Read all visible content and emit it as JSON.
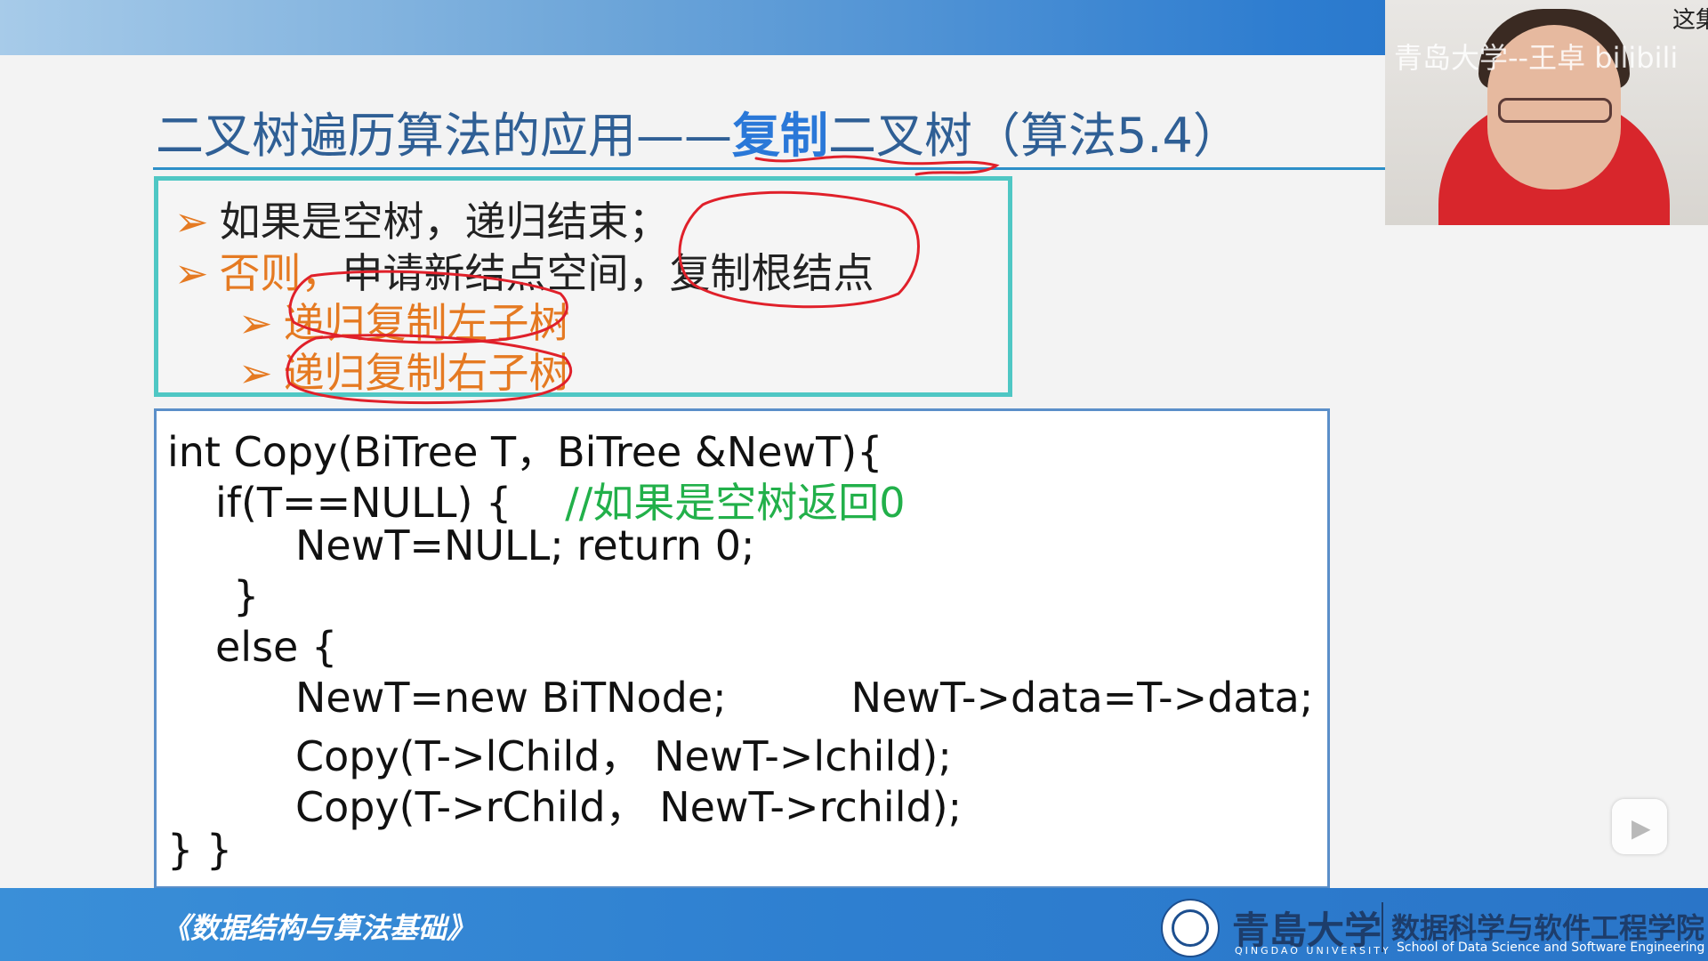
{
  "slide": {
    "title_pre": "二叉树遍历算法的应用——",
    "title_hl": "复制",
    "title_post": "二叉树（算法5.4）",
    "bullets": {
      "arrow": "➢",
      "b1": "如果是空树，递归结束；",
      "b2_orange": "否则，",
      "b2_rest": "申请新结点空间，复制根结点",
      "b3": "递归复制左子树",
      "b4": "递归复制右子树"
    },
    "code": {
      "l1": "int Copy(BiTree T，BiTree &NewT){",
      "l2": "if(T==NULL) {",
      "l2_comment": "//如果是空树返回0",
      "l3": "NewT=NULL;   return 0;",
      "l4": "}",
      "l5": "else {",
      "l6a": "NewT=new BiTNode;",
      "l6b": "NewT->data=T->data;",
      "l7": "Copy(T->lChild，  NewT->lchild);",
      "l8": "Copy(T->rChild，  NewT->rchild);",
      "l9": "} }"
    },
    "footer": {
      "book": "《数据结构与算法基础》",
      "university": "青島大学",
      "university_en": "QINGDAO UNIVERSITY",
      "school": "数据科学与软件工程学院",
      "school_en": "School of Data Science and Software Engineering"
    }
  },
  "overlay": {
    "watermark": "青岛大学--王卓 bilibili",
    "corner_text": "这集",
    "play_icon": "play-icon"
  },
  "colors": {
    "title": "#2f5f95",
    "highlight": "#2a78d8",
    "orange": "#e57a22",
    "comment": "#22b04a",
    "box_border": "#4fc7c4",
    "annotation": "#e0202a"
  }
}
